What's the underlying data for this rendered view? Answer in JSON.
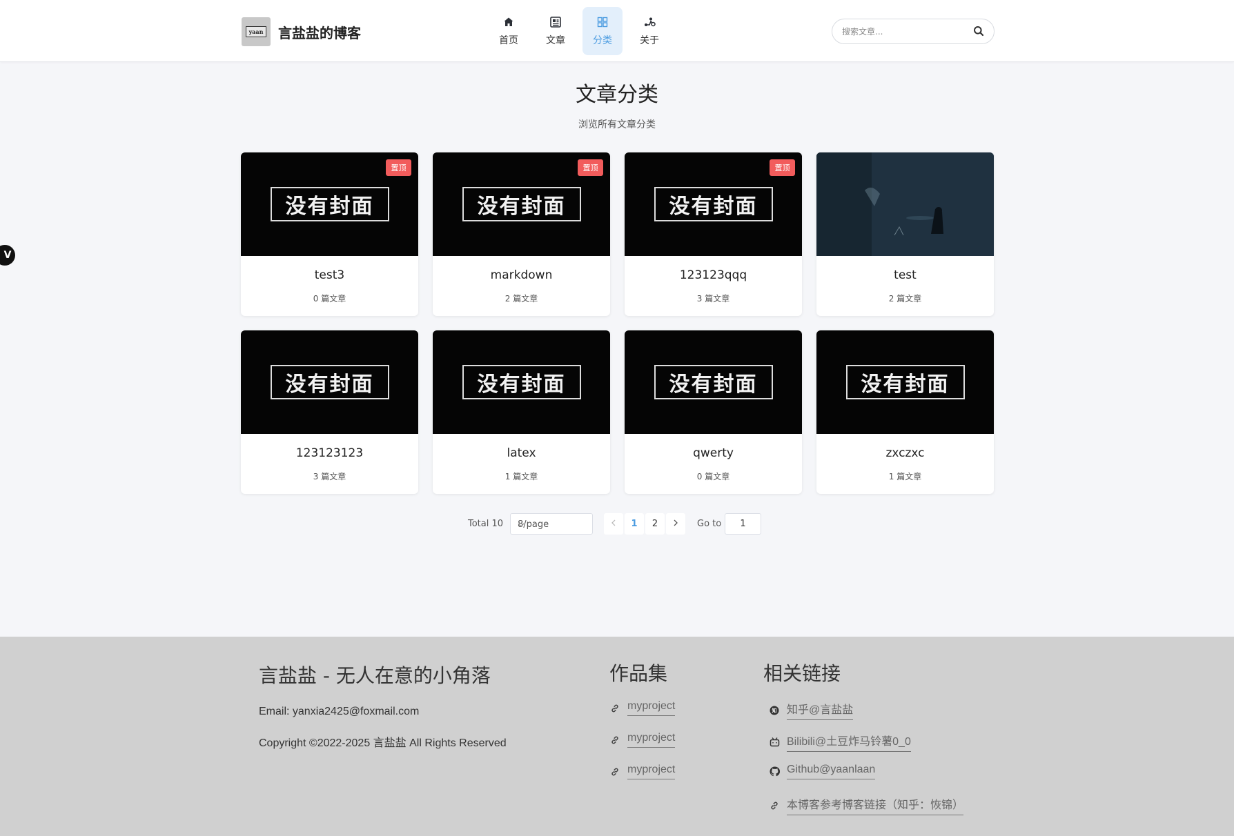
{
  "header": {
    "logo_text": "yaan",
    "site_title": "言盐盐的博客",
    "nav": [
      {
        "label": "首页",
        "icon": "home-icon",
        "active": false
      },
      {
        "label": "文章",
        "icon": "article-icon",
        "active": false
      },
      {
        "label": "分类",
        "icon": "category-icon",
        "active": true
      },
      {
        "label": "关于",
        "icon": "about-icon",
        "active": false
      }
    ],
    "search_placeholder": "搜索文章..."
  },
  "side_badge": "V",
  "page": {
    "title": "文章分类",
    "subtitle": "浏览所有文章分类"
  },
  "cover_text": "没有封面",
  "pin_label": "置顶",
  "categories": [
    {
      "name": "test3",
      "count": "0 篇文章",
      "pinned": true,
      "cover": "none"
    },
    {
      "name": "markdown",
      "count": "2 篇文章",
      "pinned": true,
      "cover": "none"
    },
    {
      "name": "123123qqq",
      "count": "3 篇文章",
      "pinned": true,
      "cover": "none"
    },
    {
      "name": "test",
      "count": "2 篇文章",
      "pinned": false,
      "cover": "photo"
    },
    {
      "name": "123123123",
      "count": "3 篇文章",
      "pinned": false,
      "cover": "none"
    },
    {
      "name": "latex",
      "count": "1 篇文章",
      "pinned": false,
      "cover": "none"
    },
    {
      "name": "qwerty",
      "count": "0 篇文章",
      "pinned": false,
      "cover": "none"
    },
    {
      "name": "zxczxc",
      "count": "1 篇文章",
      "pinned": false,
      "cover": "none"
    }
  ],
  "pagination": {
    "total": "Total 10",
    "page_size": "8/page",
    "pages": [
      "1",
      "2"
    ],
    "current": "1",
    "goto_label": "Go to",
    "goto_value": "1"
  },
  "footer": {
    "title": "言盐盐 - 无人在意的小角落",
    "email": "Email: yanxia2425@foxmail.com",
    "copyright": "Copyright ©2022-2025 言盐盐 All Rights Reserved",
    "works_heading": "作品集",
    "works": [
      "myproject",
      "myproject",
      "myproject"
    ],
    "links_heading": "相关链接",
    "links": [
      {
        "label": "知乎@言盐盐",
        "icon": "zhihu-icon"
      },
      {
        "label": "Bilibili@土豆炸马铃薯0_0",
        "icon": "bilibili-icon"
      },
      {
        "label": "Github@yaanlaan",
        "icon": "github-icon"
      },
      {
        "label": "本博客参考博客链接（知乎：恢锦）",
        "icon": "link-icon"
      }
    ]
  },
  "colors": {
    "accent": "#4a9be0",
    "pin": "#f25c5c",
    "footer_bg": "#d0d0d0"
  }
}
